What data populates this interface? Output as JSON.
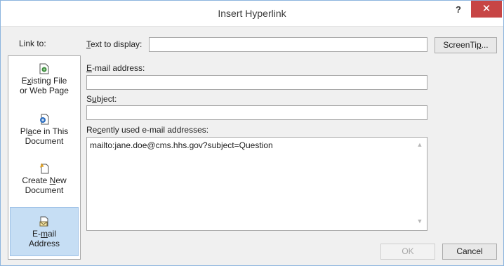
{
  "window": {
    "title": "Insert Hyperlink",
    "help_glyph": "?",
    "close_glyph": "✕"
  },
  "link_to": {
    "label": "Link to:",
    "items": [
      {
        "line1_pre": "",
        "line1_u": "x",
        "line1_post": "isting File",
        "line2": "or Web Page",
        "icon": "existing-file-icon"
      },
      {
        "line1_pre": "Pl",
        "line1_u": "a",
        "line1_post": "ce in This",
        "line2": "Document",
        "icon": "place-in-document-icon"
      },
      {
        "line1_pre": "Create ",
        "line1_u": "N",
        "line1_post": "ew",
        "line2": "Document",
        "icon": "new-document-icon"
      },
      {
        "line1_pre": "E-",
        "line1_u": "m",
        "line1_post": "ail",
        "line2": "Address",
        "icon": "email-icon",
        "selected": true
      }
    ]
  },
  "text_to_display": {
    "label_u": "T",
    "label_rest": "ext to display:",
    "value": ""
  },
  "screentip": {
    "label_pre": "ScreenTi",
    "label_u": "p",
    "label_post": "..."
  },
  "email_address": {
    "label_u": "E",
    "label_rest": "-mail address:",
    "value": ""
  },
  "subject": {
    "label_pre": "S",
    "label_u": "u",
    "label_rest": "bject:",
    "value": ""
  },
  "recent": {
    "label_pre": "Re",
    "label_u": "c",
    "label_rest": "ently used e-mail addresses:",
    "items": [
      "mailto:jane.doe@cms.hhs.gov?subject=Question"
    ]
  },
  "buttons": {
    "ok": "OK",
    "cancel": "Cancel"
  },
  "colors": {
    "accent": "#c6def4",
    "close": "#c74545"
  }
}
